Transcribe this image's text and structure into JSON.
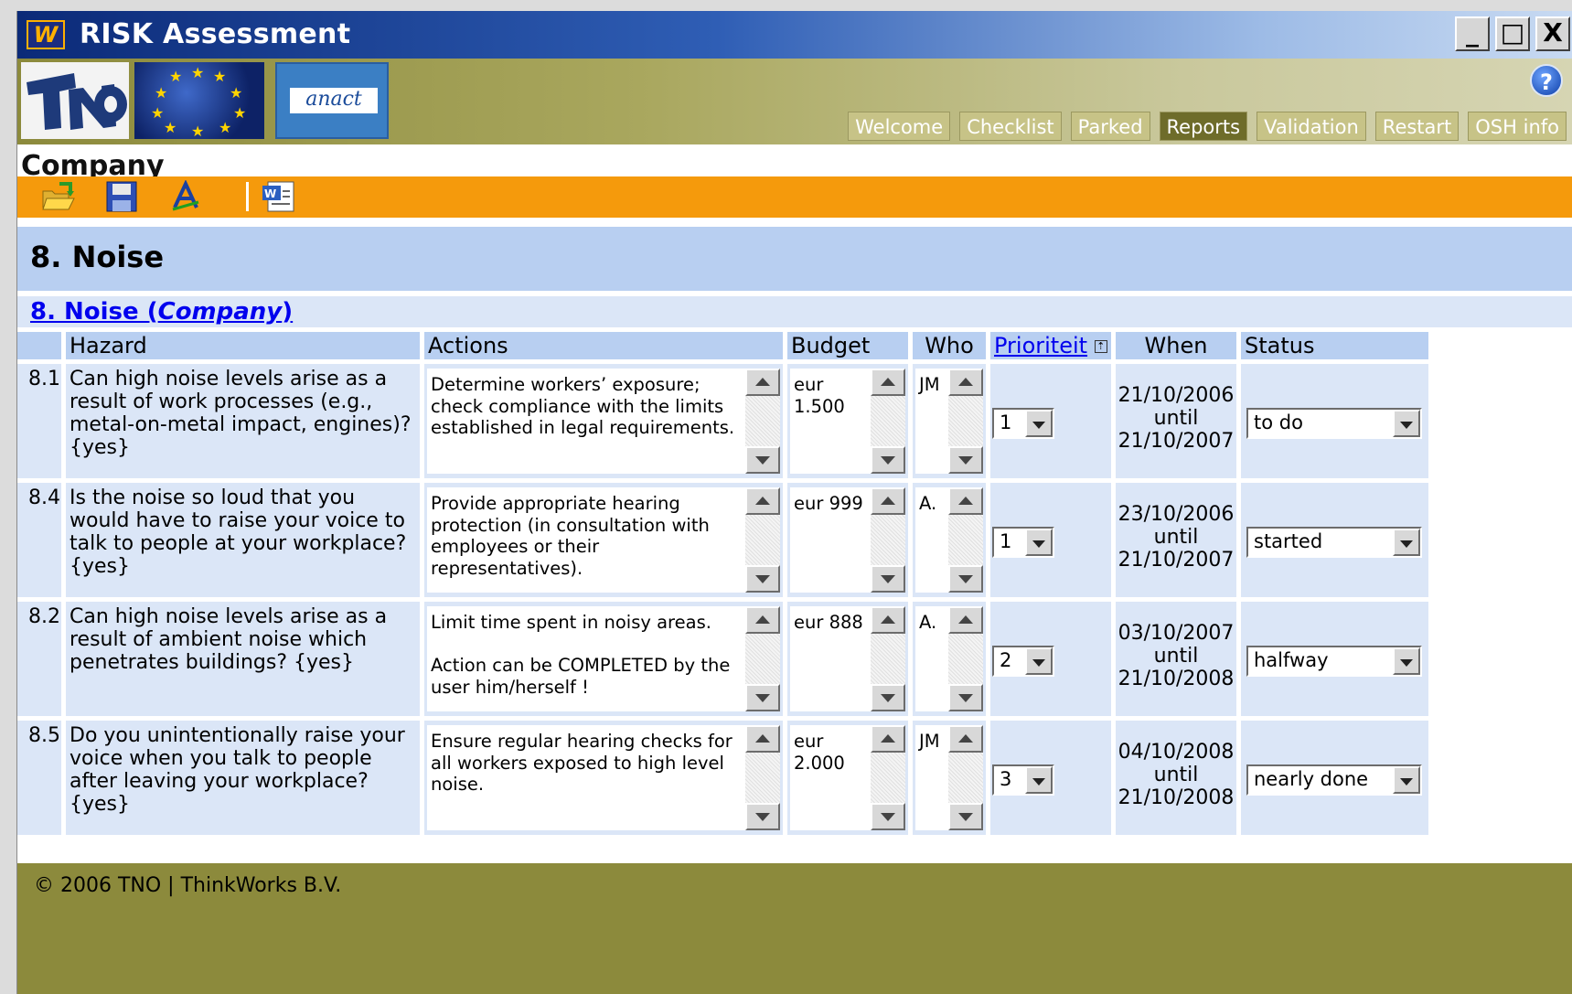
{
  "window": {
    "title": "RISK Assessment",
    "logo_text": "W",
    "controls": [
      "_",
      "□",
      "X"
    ]
  },
  "header": {
    "logos": {
      "tno": "TNO",
      "anact": "anact"
    },
    "help_label": "?",
    "tabs": [
      "Welcome",
      "Checklist",
      "Parked",
      "Reports",
      "Validation",
      "Restart",
      "OSH info"
    ],
    "active_tab": "Reports",
    "company_label": "Company"
  },
  "toolbar": {
    "icons": [
      "open-folder-icon",
      "save-disk-icon",
      "spellcheck-icon",
      "word-export-icon"
    ]
  },
  "section": {
    "title": "8. Noise",
    "subtitle_prefix": "8. Noise (",
    "subtitle_company": "Company",
    "subtitle_suffix": ")"
  },
  "columns": {
    "hazard": "Hazard",
    "actions": "Actions",
    "budget": "Budget",
    "who": "Who",
    "priority": "Prioriteit",
    "when": "When",
    "status": "Status"
  },
  "rows": [
    {
      "num": "8.1",
      "hazard": "Can high noise levels arise as a result of work processes (e.g., metal-on-metal impact, engines)? {yes}",
      "actions": "Determine workers’ exposure; check compliance with the limits established in legal requirements.",
      "budget": "eur 1.500",
      "who": "JM",
      "priority": "1",
      "when_from": "21/10/2006",
      "when_until": "until",
      "when_to": "21/10/2007",
      "status": "to do"
    },
    {
      "num": "8.4",
      "hazard": "Is the noise so loud that you would have to raise your voice to talk to people at your workplace? {yes}",
      "actions": "Provide appropriate hearing protection (in consultation with employees or their representatives).",
      "budget": "eur 999",
      "who": "A.",
      "priority": "1",
      "when_from": "23/10/2006",
      "when_until": "until",
      "when_to": "21/10/2007",
      "status": "started"
    },
    {
      "num": "8.2",
      "hazard": "Can high noise levels arise as a result of ambient noise which penetrates buildings? {yes}",
      "actions": "Limit time spent in noisy areas.\n\nAction can be COMPLETED by the user him/herself !",
      "budget": "eur 888",
      "who": "A.",
      "priority": "2",
      "when_from": "03/10/2007",
      "when_until": "until",
      "when_to": "21/10/2008",
      "status": "halfway"
    },
    {
      "num": "8.5",
      "hazard": "Do you unintentionally raise your voice when you talk to people after leaving your workplace? {yes}",
      "actions": "Ensure regular hearing checks for all workers exposed to high level noise.",
      "budget": "eur 2.000",
      "who": "JM",
      "priority": "3",
      "when_from": "04/10/2008",
      "when_until": "until",
      "when_to": "21/10/2008",
      "status": "nearly done"
    }
  ],
  "footer": "© 2006 TNO | ThinkWorks B.V."
}
